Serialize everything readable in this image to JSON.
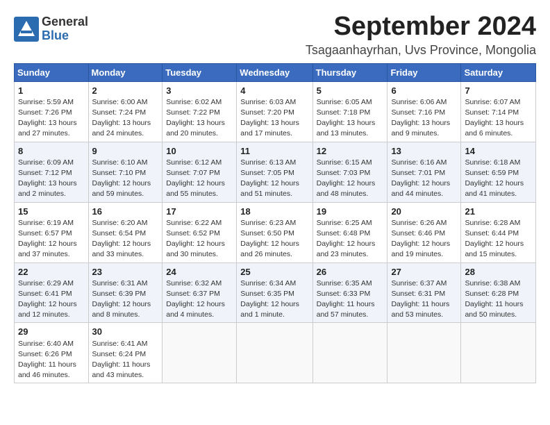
{
  "logo": {
    "general": "General",
    "blue": "Blue"
  },
  "header": {
    "month": "September 2024",
    "location": "Tsagaanhayrhan, Uvs Province, Mongolia"
  },
  "weekdays": [
    "Sunday",
    "Monday",
    "Tuesday",
    "Wednesday",
    "Thursday",
    "Friday",
    "Saturday"
  ],
  "weeks": [
    [
      {
        "day": "1",
        "info": "Sunrise: 5:59 AM\nSunset: 7:26 PM\nDaylight: 13 hours\nand 27 minutes."
      },
      {
        "day": "2",
        "info": "Sunrise: 6:00 AM\nSunset: 7:24 PM\nDaylight: 13 hours\nand 24 minutes."
      },
      {
        "day": "3",
        "info": "Sunrise: 6:02 AM\nSunset: 7:22 PM\nDaylight: 13 hours\nand 20 minutes."
      },
      {
        "day": "4",
        "info": "Sunrise: 6:03 AM\nSunset: 7:20 PM\nDaylight: 13 hours\nand 17 minutes."
      },
      {
        "day": "5",
        "info": "Sunrise: 6:05 AM\nSunset: 7:18 PM\nDaylight: 13 hours\nand 13 minutes."
      },
      {
        "day": "6",
        "info": "Sunrise: 6:06 AM\nSunset: 7:16 PM\nDaylight: 13 hours\nand 9 minutes."
      },
      {
        "day": "7",
        "info": "Sunrise: 6:07 AM\nSunset: 7:14 PM\nDaylight: 13 hours\nand 6 minutes."
      }
    ],
    [
      {
        "day": "8",
        "info": "Sunrise: 6:09 AM\nSunset: 7:12 PM\nDaylight: 13 hours\nand 2 minutes."
      },
      {
        "day": "9",
        "info": "Sunrise: 6:10 AM\nSunset: 7:10 PM\nDaylight: 12 hours\nand 59 minutes."
      },
      {
        "day": "10",
        "info": "Sunrise: 6:12 AM\nSunset: 7:07 PM\nDaylight: 12 hours\nand 55 minutes."
      },
      {
        "day": "11",
        "info": "Sunrise: 6:13 AM\nSunset: 7:05 PM\nDaylight: 12 hours\nand 51 minutes."
      },
      {
        "day": "12",
        "info": "Sunrise: 6:15 AM\nSunset: 7:03 PM\nDaylight: 12 hours\nand 48 minutes."
      },
      {
        "day": "13",
        "info": "Sunrise: 6:16 AM\nSunset: 7:01 PM\nDaylight: 12 hours\nand 44 minutes."
      },
      {
        "day": "14",
        "info": "Sunrise: 6:18 AM\nSunset: 6:59 PM\nDaylight: 12 hours\nand 41 minutes."
      }
    ],
    [
      {
        "day": "15",
        "info": "Sunrise: 6:19 AM\nSunset: 6:57 PM\nDaylight: 12 hours\nand 37 minutes."
      },
      {
        "day": "16",
        "info": "Sunrise: 6:20 AM\nSunset: 6:54 PM\nDaylight: 12 hours\nand 33 minutes."
      },
      {
        "day": "17",
        "info": "Sunrise: 6:22 AM\nSunset: 6:52 PM\nDaylight: 12 hours\nand 30 minutes."
      },
      {
        "day": "18",
        "info": "Sunrise: 6:23 AM\nSunset: 6:50 PM\nDaylight: 12 hours\nand 26 minutes."
      },
      {
        "day": "19",
        "info": "Sunrise: 6:25 AM\nSunset: 6:48 PM\nDaylight: 12 hours\nand 23 minutes."
      },
      {
        "day": "20",
        "info": "Sunrise: 6:26 AM\nSunset: 6:46 PM\nDaylight: 12 hours\nand 19 minutes."
      },
      {
        "day": "21",
        "info": "Sunrise: 6:28 AM\nSunset: 6:44 PM\nDaylight: 12 hours\nand 15 minutes."
      }
    ],
    [
      {
        "day": "22",
        "info": "Sunrise: 6:29 AM\nSunset: 6:41 PM\nDaylight: 12 hours\nand 12 minutes."
      },
      {
        "day": "23",
        "info": "Sunrise: 6:31 AM\nSunset: 6:39 PM\nDaylight: 12 hours\nand 8 minutes."
      },
      {
        "day": "24",
        "info": "Sunrise: 6:32 AM\nSunset: 6:37 PM\nDaylight: 12 hours\nand 4 minutes."
      },
      {
        "day": "25",
        "info": "Sunrise: 6:34 AM\nSunset: 6:35 PM\nDaylight: 12 hours\nand 1 minute."
      },
      {
        "day": "26",
        "info": "Sunrise: 6:35 AM\nSunset: 6:33 PM\nDaylight: 11 hours\nand 57 minutes."
      },
      {
        "day": "27",
        "info": "Sunrise: 6:37 AM\nSunset: 6:31 PM\nDaylight: 11 hours\nand 53 minutes."
      },
      {
        "day": "28",
        "info": "Sunrise: 6:38 AM\nSunset: 6:28 PM\nDaylight: 11 hours\nand 50 minutes."
      }
    ],
    [
      {
        "day": "29",
        "info": "Sunrise: 6:40 AM\nSunset: 6:26 PM\nDaylight: 11 hours\nand 46 minutes."
      },
      {
        "day": "30",
        "info": "Sunrise: 6:41 AM\nSunset: 6:24 PM\nDaylight: 11 hours\nand 43 minutes."
      },
      null,
      null,
      null,
      null,
      null
    ]
  ]
}
